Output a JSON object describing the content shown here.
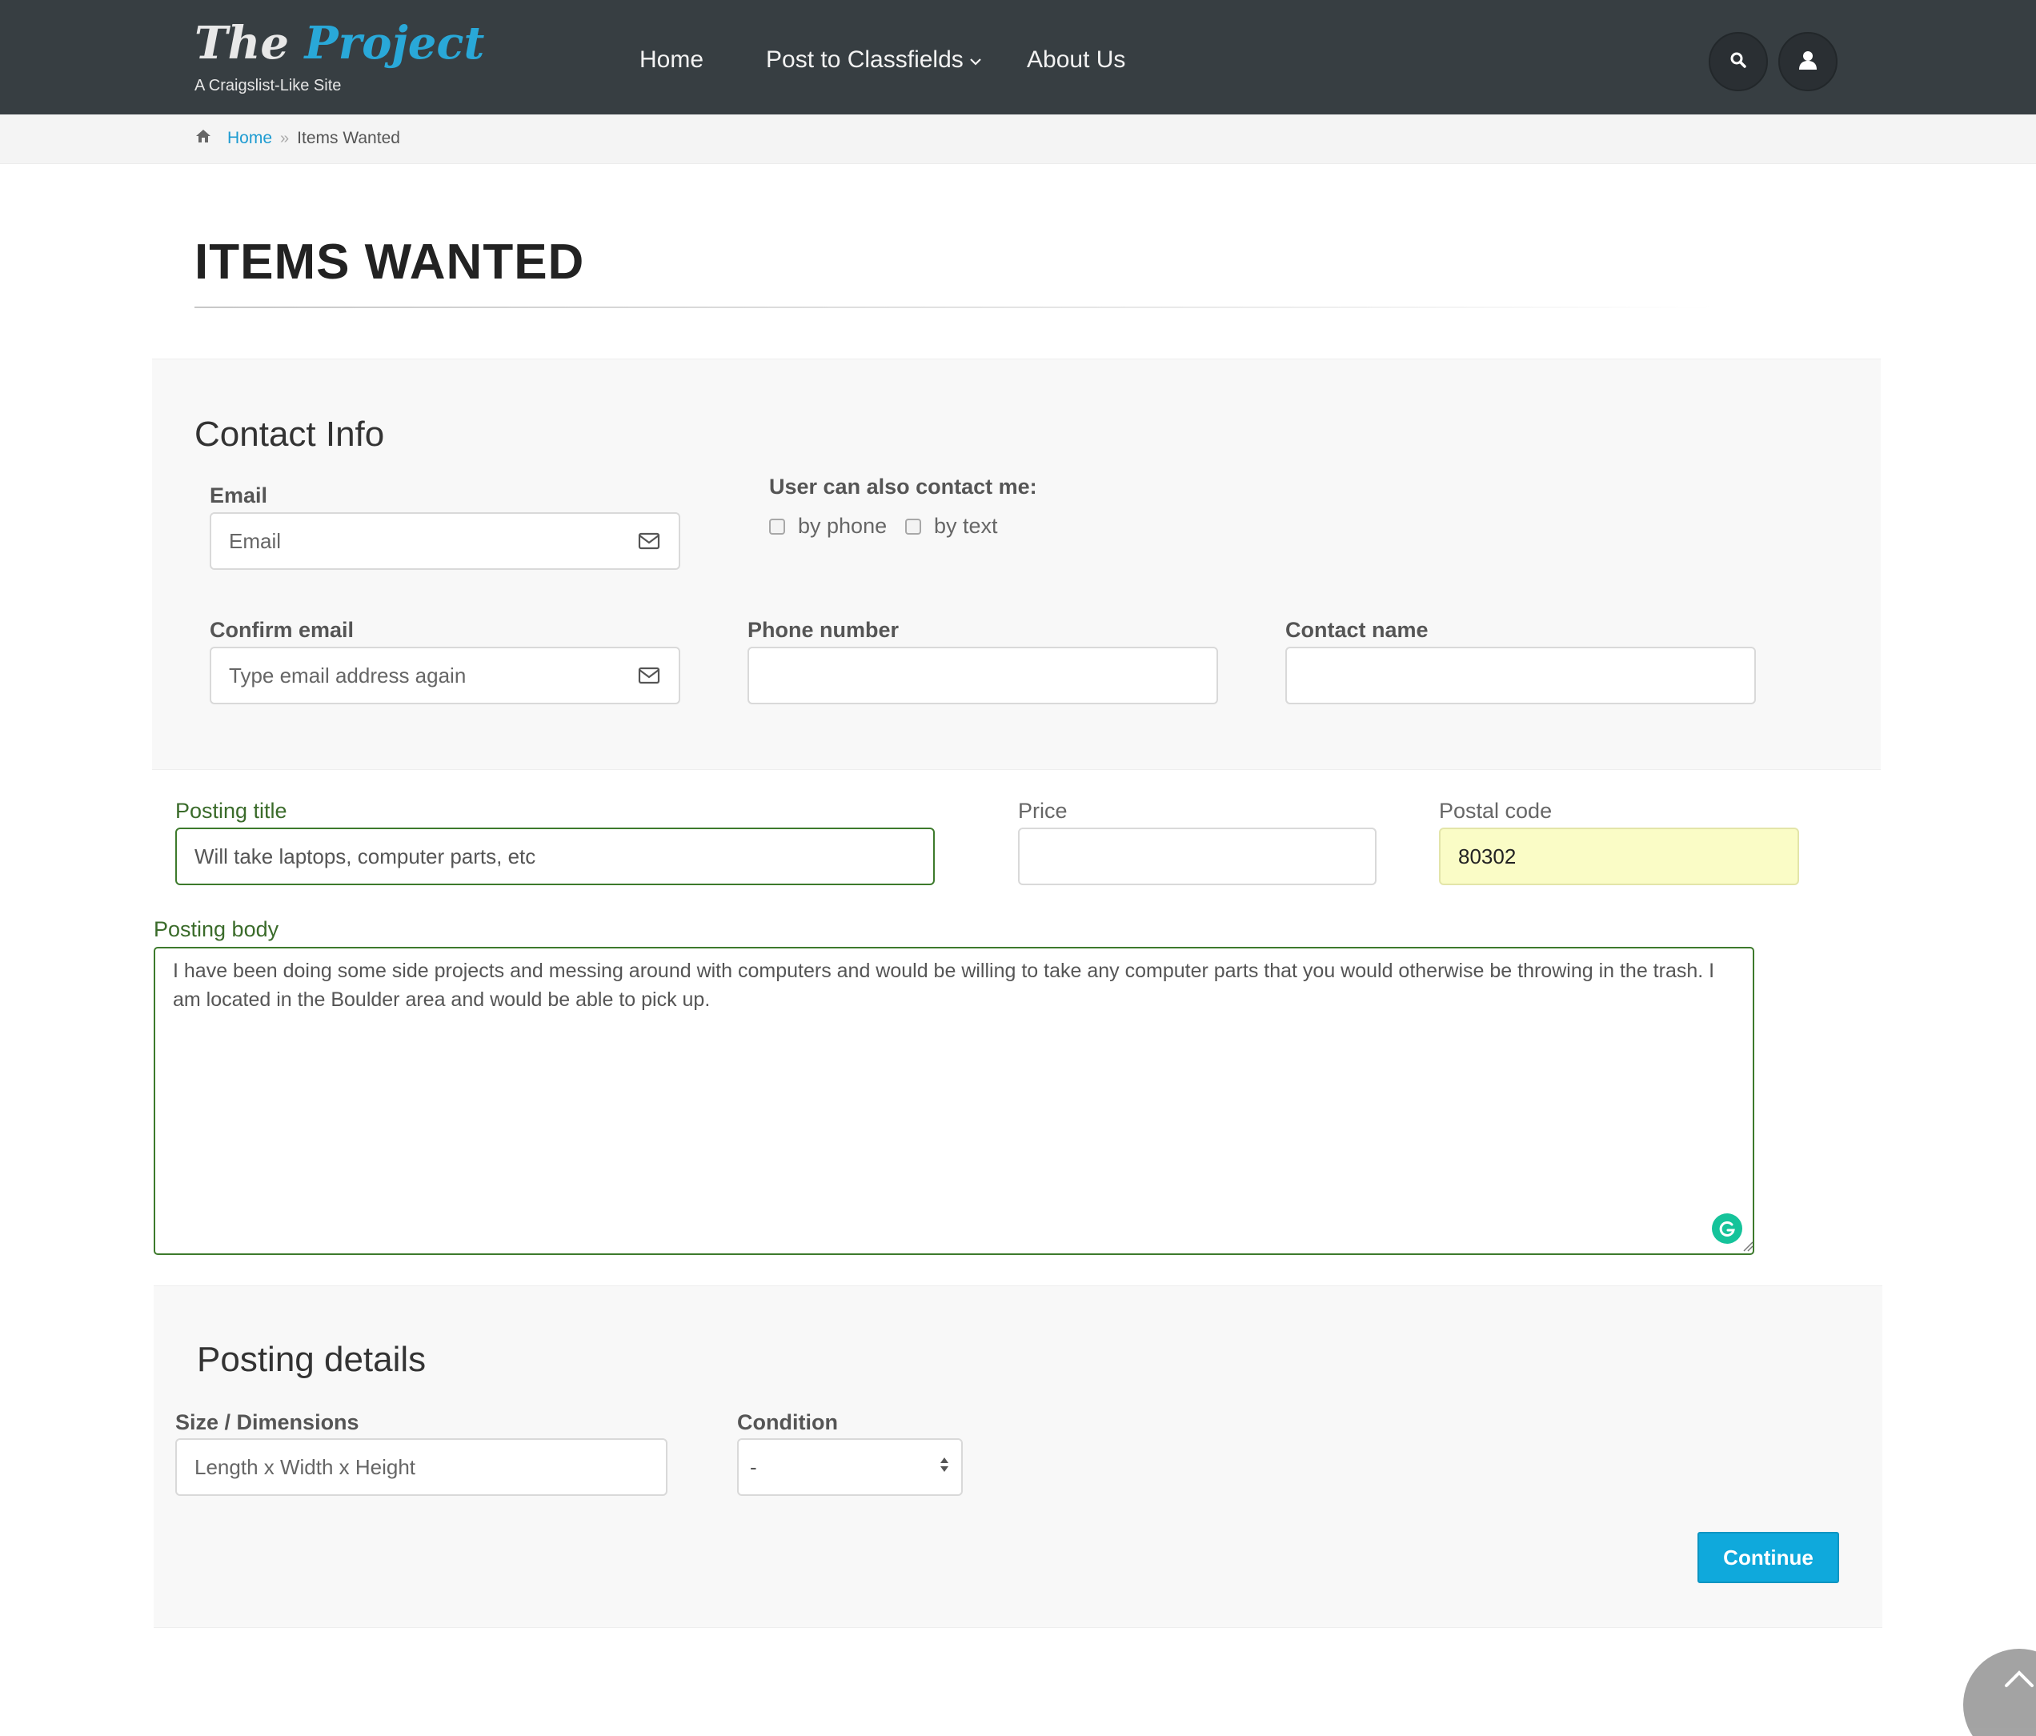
{
  "header": {
    "logo_the": "The",
    "logo_project": "Project",
    "tagline": "A Craigslist-Like Site",
    "nav": [
      {
        "label": "Home"
      },
      {
        "label": "Post to Classfields",
        "has_dropdown": true
      },
      {
        "label": "About Us"
      }
    ],
    "icons": [
      "search-icon",
      "user-icon"
    ]
  },
  "breadcrumb": {
    "home": "Home",
    "current": "Items Wanted"
  },
  "page_title": "ITEMS WANTED",
  "contact": {
    "title": "Contact Info",
    "email_label": "Email",
    "email_placeholder": "Email",
    "also_contact_label": "User can also contact me:",
    "by_phone": "by phone",
    "by_text": "by text",
    "confirm_label": "Confirm email",
    "confirm_placeholder": "Type email address again",
    "phone_label": "Phone number",
    "phone_value": "",
    "name_label": "Contact name",
    "name_value": ""
  },
  "posting": {
    "title_label": "Posting title",
    "title_value": "Will take laptops, computer parts, etc",
    "price_label": "Price",
    "price_value": "",
    "postal_label": "Postal code",
    "postal_value": "80302",
    "body_label": "Posting body",
    "body_value": "I have been doing some side projects and messing around with computers and would be willing to take any computer parts that you would otherwise be throwing in the trash. I am located in the Boulder area and would be able to pick up."
  },
  "details": {
    "title": "Posting details",
    "size_label": "Size / Dimensions",
    "size_placeholder": "Length x Width x Height",
    "condition_label": "Condition",
    "condition_value": "-",
    "continue_label": "Continue"
  },
  "colors": {
    "header_bg": "#373e42",
    "accent": "#0fa9dc",
    "valid_green": "#3d7a2c",
    "autofill_yellow": "#fafcc6"
  }
}
